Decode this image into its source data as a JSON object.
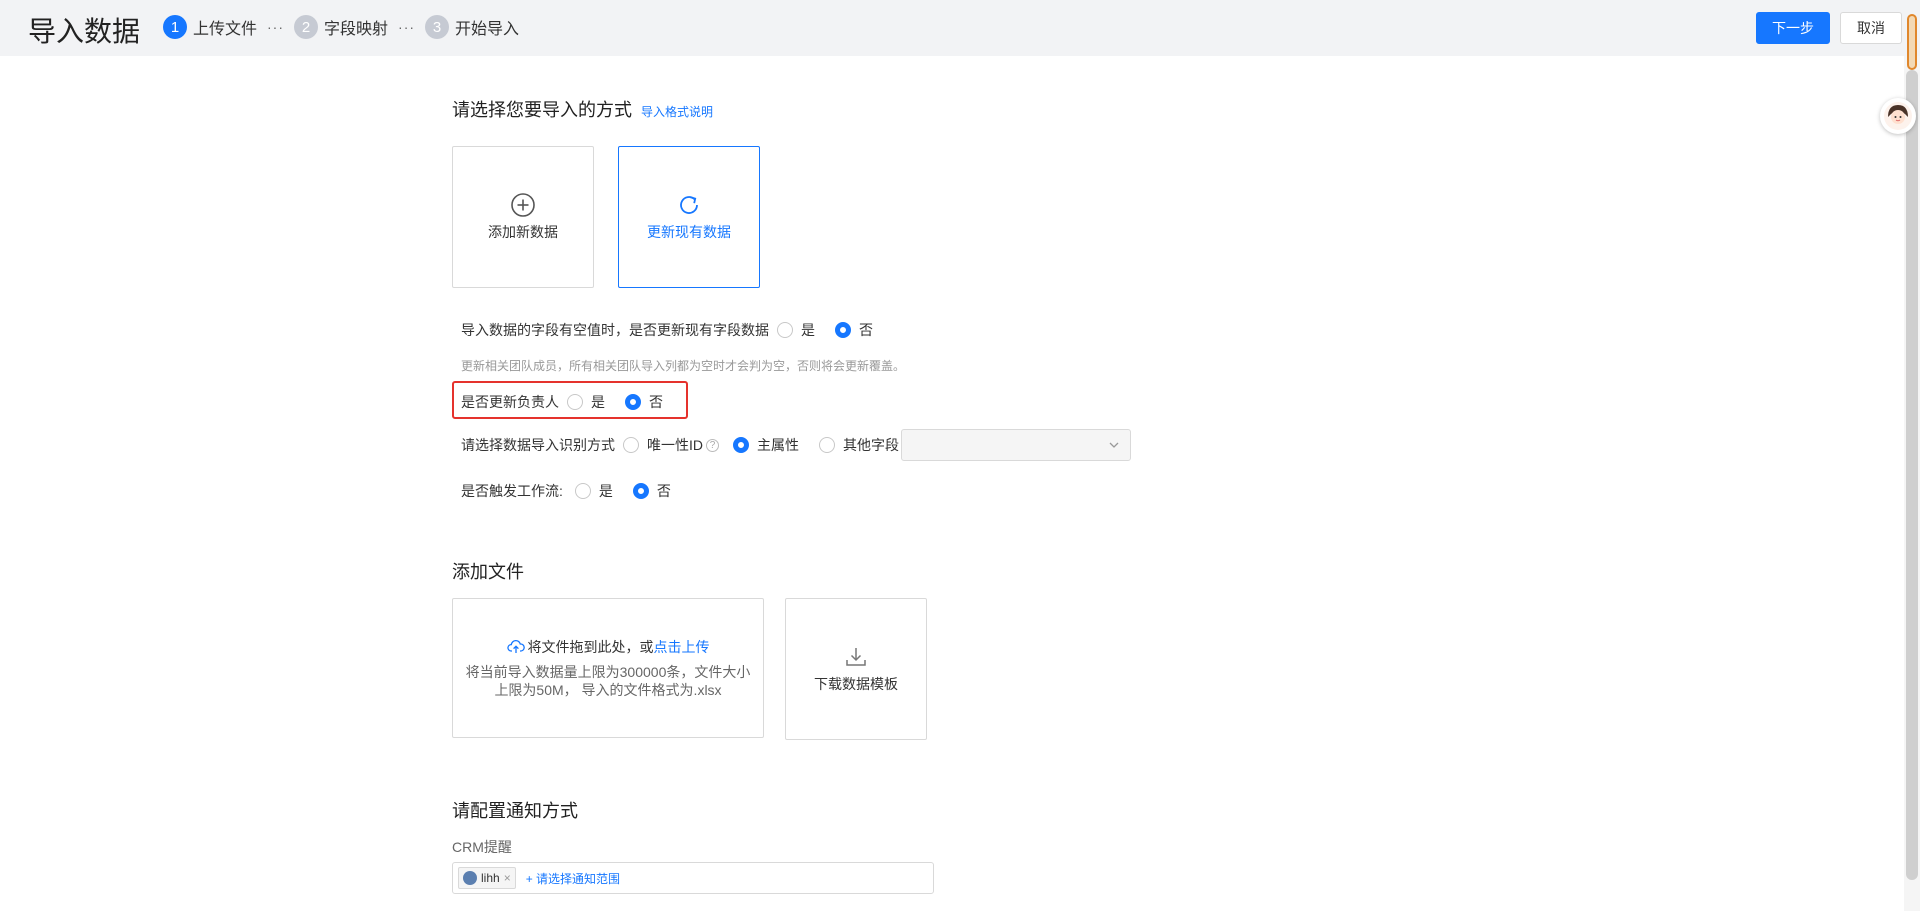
{
  "header": {
    "title": "导入数据",
    "steps": [
      {
        "num": "1",
        "label": "上传文件"
      },
      {
        "num": "2",
        "label": "字段映射"
      },
      {
        "num": "3",
        "label": "开始导入"
      }
    ],
    "dots": "···",
    "next_label": "下一步",
    "cancel_label": "取消"
  },
  "mode": {
    "title": "请选择您要导入的方式",
    "help_link": "导入格式说明",
    "cards": [
      {
        "label": "添加新数据",
        "icon": "plus-circle-icon",
        "selected": false
      },
      {
        "label": "更新现有数据",
        "icon": "refresh-icon",
        "selected": true
      }
    ]
  },
  "options": {
    "empty_field": {
      "label": "导入数据的字段有空值时，是否更新现有字段数据",
      "yes": "是",
      "no": "否",
      "selected": "否"
    },
    "team_hint": "更新相关团队成员，所有相关团队导入列都为空时才会判为空，否则将会更新覆盖。",
    "owner": {
      "label": "是否更新负责人",
      "yes": "是",
      "no": "否",
      "selected": "否"
    },
    "identify": {
      "label": "请选择数据导入识别方式",
      "opt1": "唯一性ID",
      "opt2": "主属性",
      "opt3": "其他字段",
      "selected": "主属性",
      "help": "?",
      "select_value": ""
    },
    "workflow": {
      "label": "是否触发工作流:",
      "yes": "是",
      "no": "否",
      "selected": "否"
    }
  },
  "file": {
    "title": "添加文件",
    "drop_text": "将文件拖到此处，或",
    "upload_link": "点击上传",
    "note": "将当前导入数据量上限为300000条，文件大小上限为50M， 导入的文件格式为.xlsx",
    "template_label": "下载数据模板"
  },
  "notify": {
    "title": "请配置通知方式",
    "crm_label": "CRM提醒",
    "tag_name": "lihh",
    "tag_close": "×",
    "add_scope": "+ 请选择通知范围"
  },
  "colors": {
    "primary": "#1677ff",
    "highlight": "#e5322d"
  }
}
